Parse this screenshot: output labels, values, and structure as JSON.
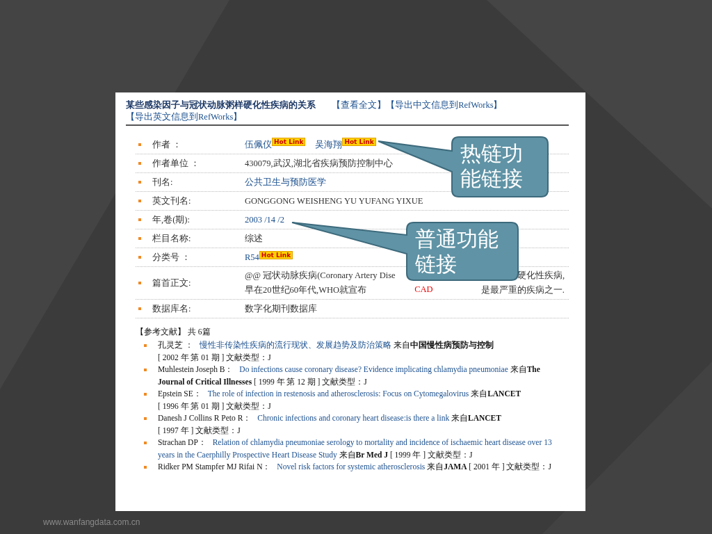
{
  "article": {
    "title": "某些感染因子与冠状动脉粥样硬化性疾病的关系",
    "actions": [
      "【查看全文】",
      "【导出中文信息到RefWorks】",
      "【导出英文信息到RefWorks】"
    ],
    "fields": [
      {
        "label": "作者 ：",
        "kind": "values",
        "values": [
          {
            "text": "伍佩仪",
            "kind": "link",
            "badge": "Hot Link"
          },
          {
            "text": "吴海翔",
            "kind": "link",
            "badge": "Hot Link"
          }
        ]
      },
      {
        "label": "作者单位 ：",
        "kind": "values",
        "values": [
          {
            "text": "430079,武汉,湖北省疾病预防控制中心",
            "kind": "plain"
          }
        ]
      },
      {
        "label": "刊名:",
        "kind": "values",
        "values": [
          {
            "text": "公共卫生与预防医学",
            "kind": "link"
          }
        ]
      },
      {
        "label": "英文刊名:",
        "kind": "values",
        "values": [
          {
            "text": "GONGGONG WEISHENG YU YUFANG YIXUE",
            "kind": "plain"
          }
        ]
      },
      {
        "label": "年,卷(期):",
        "kind": "values",
        "values": [
          {
            "text": "2003 /14 /2",
            "kind": "link"
          }
        ]
      },
      {
        "label": "栏目名称:",
        "kind": "values",
        "values": [
          {
            "text": "综述",
            "kind": "plain"
          }
        ]
      },
      {
        "label": "分类号 ：",
        "kind": "values",
        "values": [
          {
            "text": "R54",
            "kind": "link",
            "badge": "Hot Link"
          }
        ]
      },
      {
        "label": "篇首正文:",
        "kind": "abstract",
        "line_start": "@@ 冠状动脉疾病(Coronary Artery Dise",
        "line_end": "硬化性疾病,",
        "parts": [
          {
            "text": "早在20世纪60年代,WHO就宣布",
            "kind": "plain"
          },
          {
            "text": "CAD",
            "kind": "highlight"
          },
          {
            "text": "是最严重的疾病之一.",
            "kind": "plain"
          }
        ]
      },
      {
        "label": "数据库名:",
        "kind": "values",
        "values": [
          {
            "text": "数字化期刊数据库",
            "kind": "plain"
          }
        ]
      }
    ]
  },
  "references": {
    "heading": "【参考文献】 共 6篇",
    "items": [
      {
        "authors": "孔灵芝 ：",
        "title": "慢性非传染性疾病的流行现状、发展趋势及防治策略",
        "from": "来自",
        "source": "中国慢性病预防与控制",
        "details": "[ 2002 年 第 01 期 ] 文献类型：J"
      },
      {
        "authors": "Muhlestein Joseph B：",
        "title": "Do infections cause coronary disease? Evidence implicating chlamydia pneumoniae",
        "from": "来自",
        "source": "The Journal of Critical Illnesses",
        "details": "[ 1999 年 第 12 期 ] 文献类型：J"
      },
      {
        "authors": "Epstein SE：",
        "title": "The role of infection in restenosis and atherosclerosis: Focus on Cytomegalovirus",
        "from": "来自",
        "source": "LANCET",
        "details": "[ 1996 年 第 01 期 ] 文献类型：J"
      },
      {
        "authors": "Danesh J Collins R Peto R：",
        "title": "Chronic infections and coronary heart disease:is there a link",
        "from": "来自",
        "source": "LANCET",
        "details": "[ 1997 年 ] 文献类型：J"
      },
      {
        "authors": "Strachan DP：",
        "title": "Relation of chlamydia pneumoniae serology to mortality and incidence of ischaemic heart disease over 13 years in the Caerphilly Prospective Heart Disease Study",
        "from": "来自",
        "source": "Br Med J",
        "details": "[ 1999 年 ] 文献类型：J"
      },
      {
        "authors": "Ridker PM Stampfer MJ Rifai N：",
        "title": "Novel risk factors for systemic atherosclerosis",
        "from": "来自",
        "source": "JAMA",
        "details": "[ 2001 年 ] 文献类型：J"
      }
    ]
  },
  "callouts": [
    {
      "text": "热链功能链接"
    },
    {
      "text": "普通功能链接"
    }
  ],
  "footer": "www.wanfangdata.com.cn"
}
